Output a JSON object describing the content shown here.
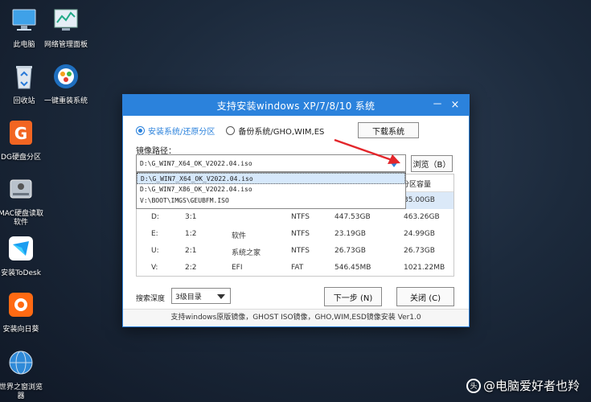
{
  "desktop": {
    "icons": [
      {
        "label": "此电脑",
        "icon": "computer-icon"
      },
      {
        "label": "网络管理面板",
        "icon": "network-panel-icon"
      },
      {
        "label": "回收站",
        "icon": "recycle-bin-icon"
      },
      {
        "label": "一键重装系统",
        "icon": "reinstall-icon"
      },
      {
        "label": "DG硬盘分区",
        "icon": "diskgenius-icon"
      },
      {
        "label": "MAC硬盘读取软件",
        "icon": "mac-disk-icon"
      },
      {
        "label": "安装ToDesk",
        "icon": "todesk-icon"
      },
      {
        "label": "安装向日葵",
        "icon": "sunflower-icon"
      },
      {
        "label": "世界之窗浏览器",
        "icon": "browser-icon"
      }
    ]
  },
  "dialog": {
    "title": "支持安装windows XP/7/8/10 系统",
    "minimize_glyph": "－",
    "close_glyph": "×",
    "radio_install": "安装系统/还原分区",
    "radio_backup": "备份系统/GHO,WIM,ES",
    "download_button": "下载系统",
    "path_label": "镜像路径：",
    "path_value": "D:\\G_WIN7_X64_OK_V2022.04.iso",
    "browse_button": "浏览（B）",
    "dropdown_options": [
      "D:\\G_WIN7_X64_OK_V2022.04.iso",
      "D:\\G_WIN7_X86_OK_V2022.04.iso",
      "V:\\BOOT\\IMGS\\GEUBFM.ISO"
    ],
    "table": {
      "header_visible": "分区容量",
      "rows": [
        {
          "drive": "",
          "part": "",
          "label": "",
          "fs": "",
          "free": "",
          "total": "35.00GB"
        },
        {
          "drive": "D:",
          "part": "3:1",
          "label": "",
          "fs": "NTFS",
          "free": "447.53GB",
          "total": "463.26GB"
        },
        {
          "drive": "E:",
          "part": "1:2",
          "label": "软件",
          "fs": "NTFS",
          "free": "23.19GB",
          "total": "24.99GB"
        },
        {
          "drive": "U:",
          "part": "2:1",
          "label": "系统之家",
          "fs": "NTFS",
          "free": "26.73GB",
          "total": "26.73GB"
        },
        {
          "drive": "V:",
          "part": "2:2",
          "label": "EFI",
          "fs": "FAT",
          "free": "546.45MB",
          "total": "1021.22MB"
        }
      ]
    },
    "depth_label": "搜索深度",
    "depth_value": "3级目录",
    "next_button": "下一步 (N)",
    "close_button": "关闭 (C)",
    "footer": "支持windows原版镜像，GHOST ISO镜像，GHO,WIM,ESD镜像安装 Ver1.0"
  },
  "watermark": {
    "logo": "头",
    "text": "@电脑爱好者也羚"
  },
  "colors": {
    "accent": "#2b82dc",
    "arrow": "#e3262b"
  }
}
